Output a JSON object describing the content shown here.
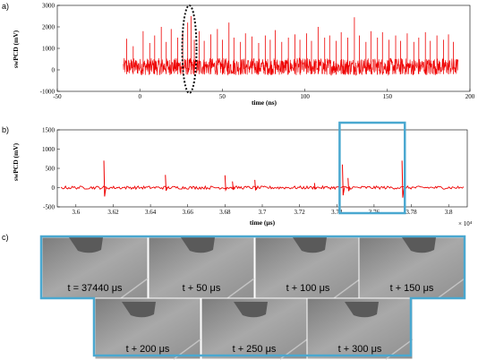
{
  "panel_labels": {
    "a": "a)",
    "b": "b)",
    "c": "c)"
  },
  "colors": {
    "signal": "#ee0000",
    "highlight": "#4aa8d0",
    "ellipse": "#111111"
  },
  "chart_data": [
    {
      "type": "line",
      "panel": "a",
      "xlabel": "time (ns)",
      "ylabel": "swPCD (mV)",
      "xlim": [
        -50,
        200
      ],
      "ylim": [
        -1000,
        3000
      ],
      "xticks": [
        -50,
        0,
        50,
        100,
        150,
        200
      ],
      "yticks": [
        -1000,
        0,
        1000,
        2000,
        3000
      ],
      "signal_range": [
        -10,
        193
      ],
      "baseline_band_mV": [
        -250,
        550
      ],
      "spikes": [
        [
          -8,
          1450
        ],
        [
          -4,
          1100
        ],
        [
          2,
          1800
        ],
        [
          6,
          1250
        ],
        [
          9,
          1600
        ],
        [
          13,
          2000
        ],
        [
          16,
          1300
        ],
        [
          19,
          1900
        ],
        [
          23,
          1500
        ],
        [
          26,
          1700
        ],
        [
          29,
          2200
        ],
        [
          31,
          2500
        ],
        [
          33,
          1400
        ],
        [
          36,
          1800
        ],
        [
          39,
          1350
        ],
        [
          43,
          1650
        ],
        [
          47,
          1900
        ],
        [
          50,
          1400
        ],
        [
          54,
          2200
        ],
        [
          57,
          1500
        ],
        [
          61,
          1300
        ],
        [
          64,
          1700
        ],
        [
          68,
          1550
        ],
        [
          72,
          1250
        ],
        [
          76,
          1600
        ],
        [
          79,
          1400
        ],
        [
          82,
          1850
        ],
        [
          86,
          1300
        ],
        [
          90,
          1500
        ],
        [
          94,
          1650
        ],
        [
          97,
          1400
        ],
        [
          101,
          1700
        ],
        [
          104,
          1350
        ],
        [
          108,
          2000
        ],
        [
          112,
          1500
        ],
        [
          115,
          1600
        ],
        [
          119,
          1350
        ],
        [
          122,
          1750
        ],
        [
          126,
          1500
        ],
        [
          130,
          2450
        ],
        [
          133,
          1600
        ],
        [
          137,
          1300
        ],
        [
          140,
          1800
        ],
        [
          144,
          1500
        ],
        [
          147,
          1750
        ],
        [
          151,
          1400
        ],
        [
          155,
          1600
        ],
        [
          158,
          1350
        ],
        [
          162,
          1700
        ],
        [
          166,
          1300
        ],
        [
          169,
          1500
        ],
        [
          173,
          1750
        ],
        [
          176,
          1350
        ],
        [
          180,
          1600
        ],
        [
          184,
          1400
        ],
        [
          187,
          1650
        ],
        [
          190,
          1300
        ]
      ],
      "annotation": {
        "shape": "dashed ellipse",
        "x_center": 30
      }
    },
    {
      "type": "line",
      "panel": "b",
      "xlabel": "time (μs)",
      "ylabel": "swPCD (mV)",
      "xlim": [
        3.59,
        3.81
      ],
      "ylim": [
        -500,
        1500
      ],
      "xticks": [
        3.6,
        3.62,
        3.64,
        3.66,
        3.68,
        3.7,
        3.72,
        3.74,
        3.76,
        3.78,
        3.8
      ],
      "yticks": [
        -500,
        0,
        500,
        1000,
        1500
      ],
      "x_multiplier": "× 10⁴",
      "baseline_band_mV": [
        -40,
        40
      ],
      "spikes": [
        [
          3.615,
          700,
          -230
        ],
        [
          3.648,
          330,
          -80
        ],
        [
          3.68,
          320,
          -60
        ],
        [
          3.684,
          160,
          -40
        ],
        [
          3.696,
          200,
          -70
        ],
        [
          3.728,
          120,
          -30
        ],
        [
          3.743,
          600,
          -200
        ],
        [
          3.746,
          250,
          -90
        ],
        [
          3.775,
          700,
          -260
        ]
      ],
      "highlight_box": [
        3.7415,
        3.7765
      ]
    }
  ],
  "frames_row1": [
    "t = 37440 μs",
    "t + 50 μs",
    "t + 100 μs",
    "t + 150 μs"
  ],
  "frames_row2": [
    "t + 200 μs",
    "t + 250 μs",
    "t + 300 μs"
  ]
}
